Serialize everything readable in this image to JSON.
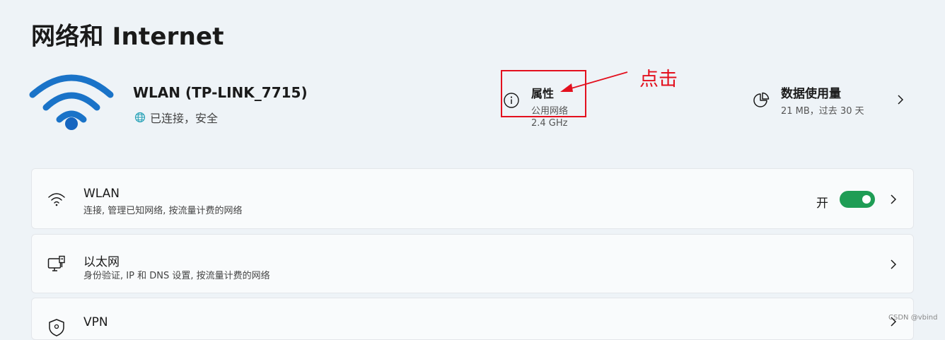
{
  "page": {
    "title": "网络和 Internet"
  },
  "network": {
    "name": "WLAN (TP-LINK_7715)",
    "status": "已连接，安全"
  },
  "properties": {
    "title": "属性",
    "network_type": "公用网络",
    "frequency": "2.4 GHz"
  },
  "annotation": {
    "text": "点击",
    "color": "#e3101e"
  },
  "data_usage": {
    "title": "数据使用量",
    "detail": "21 MB，过去 30 天"
  },
  "settings": {
    "wlan": {
      "title": "WLAN",
      "description": "连接, 管理已知网络, 按流量计费的网络",
      "toggle_label": "开",
      "toggle_on": true
    },
    "ethernet": {
      "title": "以太网",
      "description": "身份验证, IP 和 DNS 设置, 按流量计费的网络"
    },
    "vpn": {
      "title": "VPN"
    }
  },
  "watermark": "CSDN @vbind",
  "icons": {
    "wifi_large": "wifi-icon",
    "globe": "globe-icon",
    "info": "info-icon",
    "pie": "pie-chart-icon",
    "chevron": "chevron-right-icon",
    "ethernet": "ethernet-icon",
    "vpn": "shield-icon"
  },
  "colors": {
    "accent": "#1a73c8",
    "toggle_on": "#1f9d55",
    "annotation": "#e3101e",
    "background": "#eef3f7"
  }
}
